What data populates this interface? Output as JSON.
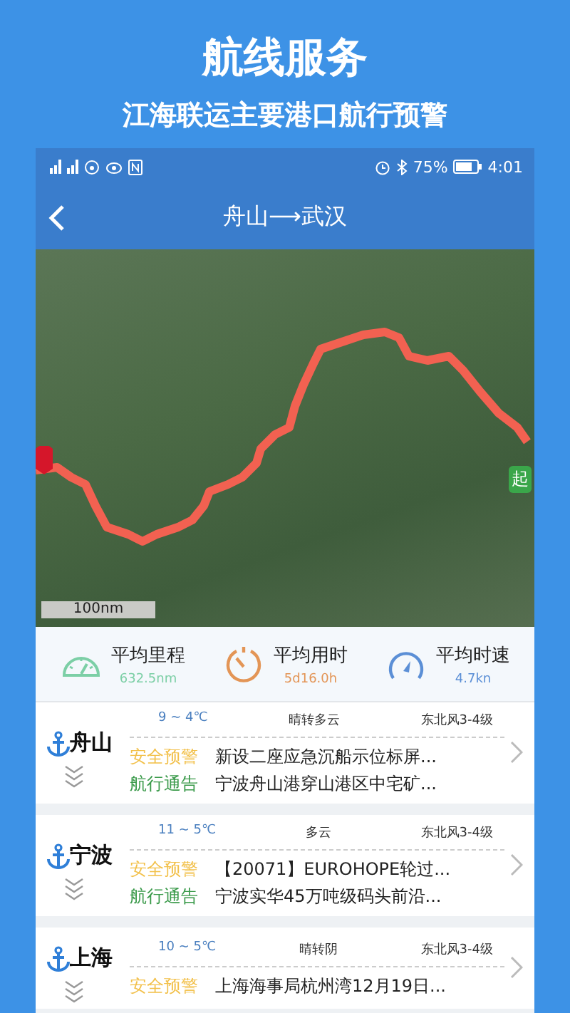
{
  "promo": {
    "title": "航线服务",
    "subtitle": "江海联运主要港口航行预警"
  },
  "status_bar": {
    "battery": "75%",
    "time": "4:01"
  },
  "nav": {
    "title": "舟山⟶武汉"
  },
  "map": {
    "scale": "100nm",
    "start_marker": "起"
  },
  "stats": [
    {
      "kind": "distance",
      "label": "平均里程",
      "value": "632.5nm",
      "color": "#7ccfa6"
    },
    {
      "kind": "time",
      "label": "平均用时",
      "value": "5d16.0h",
      "color": "#e39556"
    },
    {
      "kind": "speed",
      "label": "平均时速",
      "value": "4.7kn",
      "color": "#5b8fd6"
    }
  ],
  "ports": [
    {
      "name": "舟山",
      "temp": "9 ~ 4℃",
      "weather": "晴转多云",
      "wind": "东北风3-4级",
      "notices": [
        {
          "kind": "warning",
          "label": "安全预警",
          "text": "新设二座应急沉船示位标屏..."
        },
        {
          "kind": "notice",
          "label": "航行通告",
          "text": "宁波舟山港穿山港区中宅矿..."
        }
      ]
    },
    {
      "name": "宁波",
      "temp": "11 ~ 5℃",
      "weather": "多云",
      "wind": "东北风3-4级",
      "notices": [
        {
          "kind": "warning",
          "label": "安全预警",
          "text": "【20071】EUROHOPE轮过..."
        },
        {
          "kind": "notice",
          "label": "航行通告",
          "text": "宁波实华45万吨级码头前沿..."
        }
      ]
    },
    {
      "name": "上海",
      "temp": "10 ~ 5℃",
      "weather": "晴转阴",
      "wind": "东北风3-4级",
      "notices": [
        {
          "kind": "warning",
          "label": "安全预警",
          "text": "上海海事局杭州湾12月19日..."
        }
      ]
    }
  ]
}
